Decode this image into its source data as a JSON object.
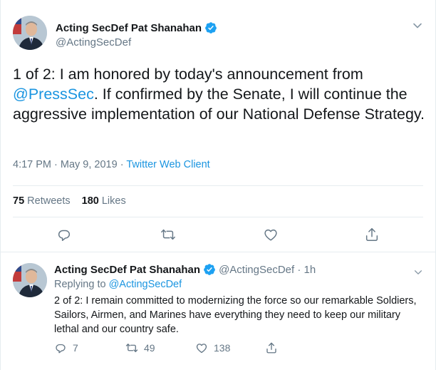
{
  "main_tweet": {
    "author_name": "Acting SecDef Pat Shanahan",
    "handle": "@ActingSecDef",
    "text_line1": "1 of 2: I am honored by today's announcement from",
    "mention": "@PressSec",
    "text_rest": ".  If confirmed by the Senate, I will continue the aggressive implementation of our National Defense Strategy.",
    "time": "4:17 PM · May 9, 2019 · ",
    "source": "Twitter Web Client",
    "retweets_count": "75",
    "retweets_label": "Retweets",
    "likes_count": "180",
    "likes_label": "Likes",
    "icons": [
      "reply-icon",
      "retweet-icon",
      "like-icon",
      "share-icon",
      "chevron-down-icon",
      "verified-badge-icon"
    ]
  },
  "reply_tweet": {
    "author_name": "Acting SecDef Pat Shanahan",
    "handle_time": "@ActingSecDef · 1h",
    "replying_prefix": "Replying to ",
    "replying_to": "@ActingSecDef",
    "text": "2 of 2: I remain committed to modernizing the force so our remarkable Soldiers, Sailors, Airmen, and Marines have everything they need to keep our military lethal and our country safe.",
    "reply_count": "7",
    "retweet_count": "49",
    "like_count": "138"
  },
  "colors": {
    "link": "#1b95e0",
    "secondary_text": "#657786",
    "primary_text": "#14171a",
    "border": "#e6ecf0",
    "verified": "#1da1f2"
  }
}
